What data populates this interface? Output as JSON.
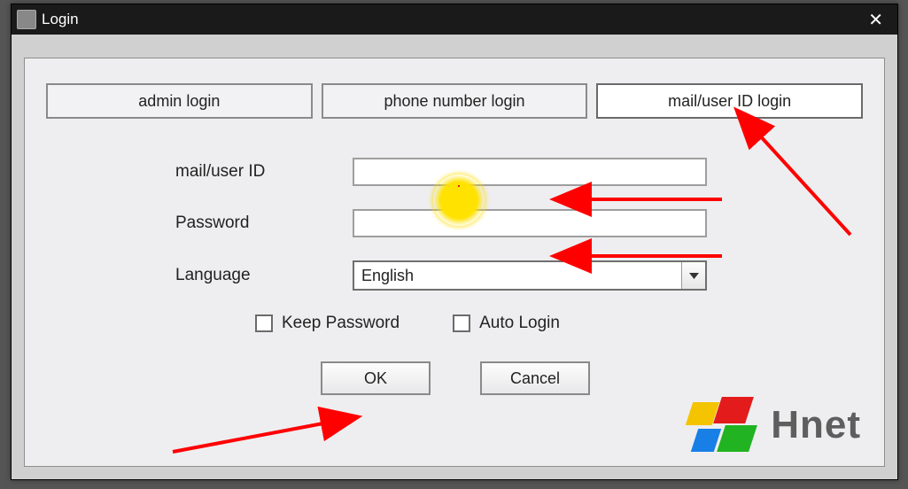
{
  "window": {
    "title": "Login",
    "close_glyph": "✕"
  },
  "tabs": [
    {
      "label": "admin login"
    },
    {
      "label": "phone number login"
    },
    {
      "label": "mail/user ID login"
    }
  ],
  "fields": {
    "userid": {
      "label": "mail/user ID",
      "value": ""
    },
    "password": {
      "label": "Password",
      "value": ""
    },
    "language": {
      "label": "Language",
      "selected": "English"
    }
  },
  "checks": {
    "keep": "Keep Password",
    "auto": "Auto Login"
  },
  "buttons": {
    "ok": "OK",
    "cancel": "Cancel"
  },
  "brand": {
    "text": "Hnet"
  },
  "annotations": {
    "highlight_circle": true,
    "arrows": 4
  }
}
